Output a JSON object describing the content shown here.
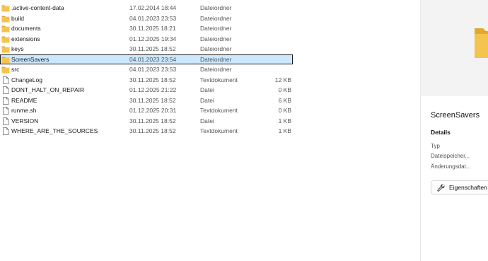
{
  "files": [
    {
      "name": ".active-content-data",
      "date": "17.02.2014 18:44",
      "type": "Dateiordner",
      "size": "",
      "icon": "folder-icon"
    },
    {
      "name": "build",
      "date": "04.01.2023 23:53",
      "type": "Dateiordner",
      "size": "",
      "icon": "folder-icon"
    },
    {
      "name": "documents",
      "date": "30.11.2025 18:21",
      "type": "Dateiordner",
      "size": "",
      "icon": "folder-icon"
    },
    {
      "name": "extensions",
      "date": "01.12.2025 19:34",
      "type": "Dateiordner",
      "size": "",
      "icon": "folder-icon"
    },
    {
      "name": "keys",
      "date": "30.11.2025 18:52",
      "type": "Dateiordner",
      "size": "",
      "icon": "folder-icon"
    },
    {
      "name": "ScreenSavers",
      "date": "04.01.2023 23:54",
      "type": "Dateiordner",
      "size": "",
      "icon": "folder-icon",
      "selected": true
    },
    {
      "name": "src",
      "date": "04.01.2023 23:53",
      "type": "Dateiordner",
      "size": "",
      "icon": "folder-icon"
    },
    {
      "name": "ChangeLog",
      "date": "30.11.2025 18:52",
      "type": "Textdokument",
      "size": "12 KB",
      "icon": "document-icon"
    },
    {
      "name": "DONT_HALT_ON_REPAIR",
      "date": "01.12.2025 21:22",
      "type": "Datei",
      "size": "0 KB",
      "icon": "document-icon"
    },
    {
      "name": "README",
      "date": "30.11.2025 18:52",
      "type": "Datei",
      "size": "6 KB",
      "icon": "document-icon"
    },
    {
      "name": "runme.sh",
      "date": "01.12.2025 20:31",
      "type": "Textdokument",
      "size": "0 KB",
      "icon": "document-icon"
    },
    {
      "name": "VERSION",
      "date": "30.11.2025 18:52",
      "type": "Datei",
      "size": "1 KB",
      "icon": "document-icon"
    },
    {
      "name": "WHERE_ARE_THE_SOURCES",
      "date": "30.11.2025 18:52",
      "type": "Textdokument",
      "size": "1 KB",
      "icon": "document-icon"
    }
  ],
  "details": {
    "title": "ScreenSavers",
    "section": "Details",
    "props": [
      "Typ",
      "Dateispeicher...",
      "Änderungsdat..."
    ],
    "properties_button": "Eigenschaften"
  },
  "colors": {
    "folder": "#f5c44e",
    "folder_dark": "#e0a82e",
    "selection": "#cce8ff"
  }
}
